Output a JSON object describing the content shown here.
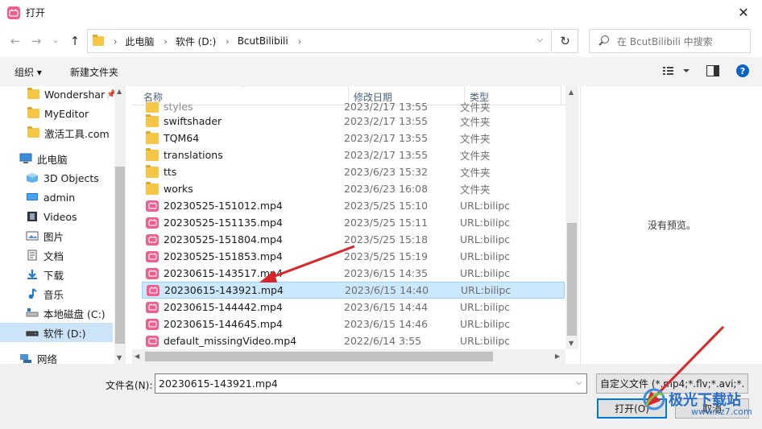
{
  "window": {
    "title": "打开",
    "close_glyph": "✕"
  },
  "nav": {
    "back_glyph": "←",
    "forward_glyph": "→",
    "recent_glyph": "⌄",
    "up_glyph": "↑",
    "breadcrumbs": [
      "此电脑",
      "软件 (D:)",
      "BcutBilibili"
    ],
    "refresh_glyph": "↻",
    "search_placeholder": "在 BcutBilibili 中搜索"
  },
  "toolbar": {
    "organize": "组织 ▾",
    "new_folder": "新建文件夹",
    "help": "?"
  },
  "sidebar": {
    "items": [
      {
        "label": "Wondershar",
        "icon": "folder-icon",
        "pinned": true
      },
      {
        "label": "MyEditor",
        "icon": "folder-icon"
      },
      {
        "label": "激活工具.com",
        "icon": "folder-icon"
      },
      {
        "label": "此电脑",
        "icon": "computer-icon"
      },
      {
        "label": "3D Objects",
        "icon": "3d-objects-icon"
      },
      {
        "label": "admin",
        "icon": "desktop-icon"
      },
      {
        "label": "Videos",
        "icon": "videos-icon"
      },
      {
        "label": "图片",
        "icon": "pictures-icon"
      },
      {
        "label": "文档",
        "icon": "documents-icon"
      },
      {
        "label": "下载",
        "icon": "downloads-icon"
      },
      {
        "label": "音乐",
        "icon": "music-icon"
      },
      {
        "label": "本地磁盘 (C:)",
        "icon": "drive-c-icon"
      },
      {
        "label": "软件 (D:)",
        "icon": "drive-d-icon",
        "selected": true
      },
      {
        "label": "网络",
        "icon": "network-icon"
      }
    ]
  },
  "columns": {
    "name": "名称",
    "date": "修改日期",
    "type": "类型"
  },
  "files": [
    {
      "name": "swiftshader",
      "date": "2023/2/17 13:55",
      "type": "文件夹",
      "kind": "folder"
    },
    {
      "name": "TQM64",
      "date": "2023/2/17 13:55",
      "type": "文件夹",
      "kind": "folder"
    },
    {
      "name": "translations",
      "date": "2023/2/17 13:55",
      "type": "文件夹",
      "kind": "folder"
    },
    {
      "name": "tts",
      "date": "2023/6/23 15:32",
      "type": "文件夹",
      "kind": "folder"
    },
    {
      "name": "works",
      "date": "2023/6/23 16:08",
      "type": "文件夹",
      "kind": "folder"
    },
    {
      "name": "20230525-151012.mp4",
      "date": "2023/5/25 15:10",
      "type": "URL:bilipc",
      "kind": "mp4"
    },
    {
      "name": "20230525-151135.mp4",
      "date": "2023/5/25 15:11",
      "type": "URL:bilipc",
      "kind": "mp4"
    },
    {
      "name": "20230525-151804.mp4",
      "date": "2023/5/25 15:18",
      "type": "URL:bilipc",
      "kind": "mp4"
    },
    {
      "name": "20230525-151853.mp4",
      "date": "2023/5/25 15:19",
      "type": "URL:bilipc",
      "kind": "mp4"
    },
    {
      "name": "20230615-143517.mp4",
      "date": "2023/6/15 14:35",
      "type": "URL:bilipc",
      "kind": "mp4"
    },
    {
      "name": "20230615-143921.mp4",
      "date": "2023/6/15 14:40",
      "type": "URL:bilipc",
      "kind": "mp4",
      "selected": true
    },
    {
      "name": "20230615-144442.mp4",
      "date": "2023/6/15 14:44",
      "type": "URL:bilipc",
      "kind": "mp4"
    },
    {
      "name": "20230615-144645.mp4",
      "date": "2023/6/15 14:46",
      "type": "URL:bilipc",
      "kind": "mp4"
    },
    {
      "name": "default_missingVideo.mp4",
      "date": "2022/6/14 3:55",
      "type": "URL:bilipc",
      "kind": "mp4"
    }
  ],
  "preview": {
    "text": "没有预览。"
  },
  "footer": {
    "filename_label": "文件名(N):",
    "filename_value": "20230615-143921.mp4",
    "filter_value": "自定义文件 (*.mp4;*.flv;*.avi;*.",
    "open_label": "打开(O)",
    "cancel_label": "取消"
  },
  "watermark": {
    "text": "极光下载站",
    "url": "www.xz7.com"
  },
  "colors": {
    "accent": "#0078d7",
    "selection": "#cce8ff",
    "annotation_arrow": "#d9262b",
    "bilibili_pink": "#f25d8e"
  }
}
